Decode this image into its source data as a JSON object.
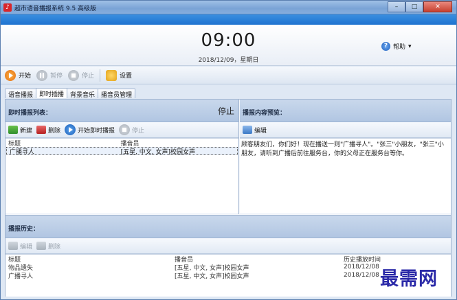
{
  "window": {
    "title": "超市语音播报系统 9.5 高级版"
  },
  "header": {
    "time": "09:00",
    "date": "2018/12/09，星期日",
    "help_label": "帮助",
    "help_arrow": "▾"
  },
  "toolbar": {
    "start": "开始",
    "pause": "暂停",
    "stop": "停止",
    "settings": "设置"
  },
  "tabs": [
    "语音播报",
    "即时插播",
    "背景音乐",
    "播音员管理"
  ],
  "instant": {
    "title": "即时播报列表：",
    "status": "停止",
    "buttons": {
      "new": "新建",
      "delete": "删除",
      "start_now": "开始即时播报",
      "stop": "停止"
    },
    "columns": [
      "标题",
      "播音员"
    ],
    "rows": [
      {
        "title": "广播寻人",
        "announcer": "[五星, 中文, 女声]校园女声"
      }
    ]
  },
  "preview": {
    "title": "播报内容预览：",
    "edit_label": "编辑",
    "text": "顾客朋友们，你们好！现在播送一则\"广播寻人\"。\"张三\"小朋友，\"张三\"小朋友，请听到广播后前往服务台，你的父母正在服务台等你。"
  },
  "history": {
    "title": "播报历史：",
    "buttons": {
      "edit": "编辑",
      "delete": "删除"
    },
    "columns": [
      "标题",
      "播音员",
      "历史播放时间"
    ],
    "rows": [
      {
        "title": "物品遗失",
        "announcer": "[五星, 中文, 女声]校园女声",
        "time": "2018/12/08"
      },
      {
        "title": "广播寻人",
        "announcer": "[五星, 中文, 女声]校园女声",
        "time": "2018/12/08"
      }
    ]
  },
  "watermark": "最需网"
}
